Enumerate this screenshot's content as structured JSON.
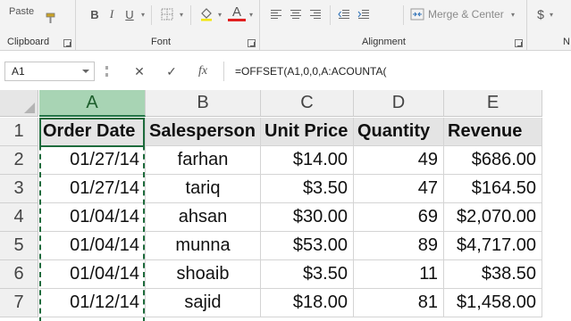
{
  "ribbon": {
    "clipboard": {
      "paste_label": "Paste",
      "group_label": "Clipboard"
    },
    "font": {
      "group_label": "Font",
      "bold": "B",
      "italic": "I",
      "underline": "U",
      "font_color_glyph": "A"
    },
    "alignment": {
      "group_label": "Alignment",
      "merge_center_label": "Merge & Center"
    },
    "number": {
      "currency_glyph": "$",
      "group_label": "N"
    }
  },
  "formula_bar": {
    "name_box": "A1",
    "cancel_glyph": "✕",
    "enter_glyph": "✓",
    "fx_glyph": "fx",
    "formula": "=OFFSET(A1,0,0,A:ACOUNTA("
  },
  "sheet": {
    "columns": [
      "A",
      "B",
      "C",
      "D",
      "E"
    ],
    "rows": [
      "1",
      "2",
      "3",
      "4",
      "5",
      "6",
      "7"
    ],
    "header": [
      "Order Date",
      "Salesperson",
      "Unit Price",
      "Quantity",
      "Revenue"
    ],
    "data": [
      [
        "01/27/14",
        "farhan",
        "$14.00",
        "49",
        "$686.00"
      ],
      [
        "01/27/14",
        "tariq",
        "$3.50",
        "47",
        "$164.50"
      ],
      [
        "01/04/14",
        "ahsan",
        "$30.00",
        "69",
        "$2,070.00"
      ],
      [
        "01/04/14",
        "munna",
        "$53.00",
        "89",
        "$4,717.00"
      ],
      [
        "01/04/14",
        "shoaib",
        "$3.50",
        "11",
        "$38.50"
      ],
      [
        "01/12/14",
        "sajid",
        "$18.00",
        "81",
        "$1,458.00"
      ]
    ],
    "selected_column": "A",
    "colors": {
      "selection_green": "#1e6b3c",
      "header_fill": "#e4e4e4"
    }
  }
}
